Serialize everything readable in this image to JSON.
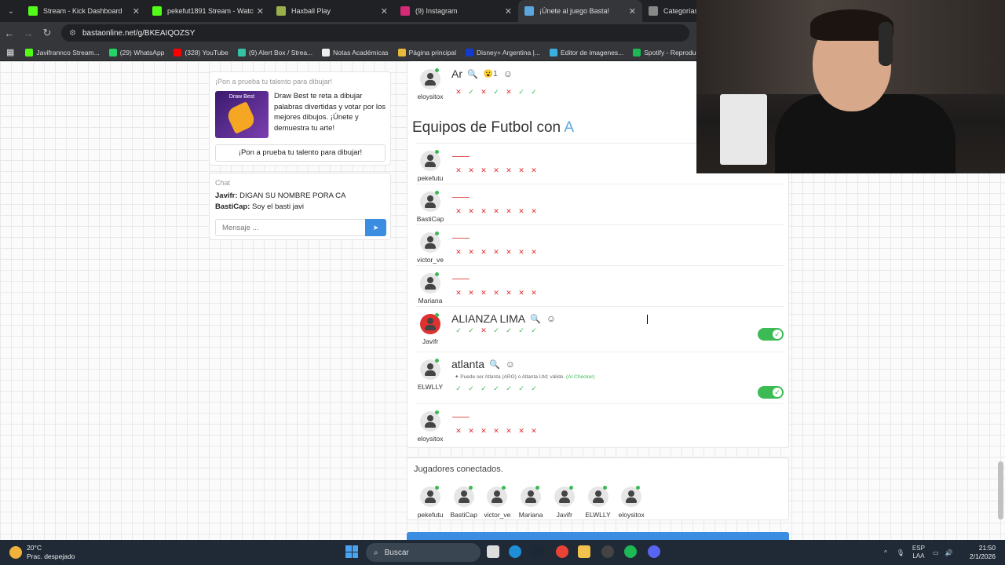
{
  "browser": {
    "tabs": [
      {
        "label": "Stream - Kick Dashboard",
        "color": "#53fc18"
      },
      {
        "label": "pekefut1891 Stream - Watch Li",
        "color": "#53fc18"
      },
      {
        "label": "Haxball Play",
        "color": "#9ab04a"
      },
      {
        "label": "(9) Instagram",
        "color": "#d62976"
      },
      {
        "label": "¡Únete al juego Basta!",
        "color": "#5aa7e0"
      },
      {
        "label": "Categorías Tr",
        "color": "#888888"
      }
    ],
    "active_tab": 4,
    "url": "bastaonline.net/g/BKEAIQOZSY",
    "bookmarks": [
      {
        "label": "Javifrannco Stream...",
        "color": "#53fc18"
      },
      {
        "label": "(29) WhatsApp",
        "color": "#25d366"
      },
      {
        "label": "(328) YouTube",
        "color": "#ff0000"
      },
      {
        "label": "(9) Alert Box / Strea...",
        "color": "#31c3a2"
      },
      {
        "label": "Notas Académicas",
        "color": "#eeeeee"
      },
      {
        "label": "Página principal",
        "color": "#e8b83a"
      },
      {
        "label": "Disney+ Argentina |...",
        "color": "#113ccf"
      },
      {
        "label": "Editor de imagenes...",
        "color": "#3ab0e0"
      },
      {
        "label": "Spotify - Reproduct...",
        "color": "#1db954"
      }
    ]
  },
  "promo": {
    "heading": "¡Pon a prueba tu talento para dibujar!",
    "image_title": "Draw Best",
    "text": "Draw Best te reta a dibujar palabras divertidas y votar por los mejores dibujos. ¡Únete y demuestra tu arte!",
    "button": "¡Pon a prueba tu talento para dibujar!"
  },
  "chat": {
    "heading": "Chat",
    "messages": [
      {
        "user": "Javifr:",
        "text": "DIGAN SU NOMBRE PORA CA"
      },
      {
        "user": "BastiCap:",
        "text": "Soy el basti javi"
      }
    ],
    "placeholder": "Mensaje ..."
  },
  "prev_answer": {
    "word": "Ar",
    "reaction": "😮1",
    "player": "eloysitox",
    "votes": [
      "x",
      "ok",
      "x",
      "ok",
      "x",
      "ok",
      "ok"
    ]
  },
  "category": {
    "title": "Equipos de Futbol con",
    "letter": "A"
  },
  "answers": [
    {
      "player": "pekefutu",
      "answer": "",
      "votes": [
        "x",
        "x",
        "x",
        "x",
        "x",
        "x",
        "x"
      ],
      "toggle": false
    },
    {
      "player": "BastiCap",
      "answer": "",
      "votes": [
        "x",
        "x",
        "x",
        "x",
        "x",
        "x",
        "x"
      ],
      "toggle": false
    },
    {
      "player": "victor_ve",
      "answer": "",
      "votes": [
        "x",
        "x",
        "x",
        "x",
        "x",
        "x",
        "x"
      ],
      "toggle": false
    },
    {
      "player": "Mariana",
      "answer": "",
      "votes": [
        "x",
        "x",
        "x",
        "x",
        "x",
        "x",
        "x"
      ],
      "toggle": false
    },
    {
      "player": "Javifr",
      "answer": "ALIANZA LIMA",
      "votes": [
        "ok",
        "ok",
        "x",
        "ok",
        "ok",
        "ok",
        "ok"
      ],
      "toggle": true,
      "stop": true
    },
    {
      "player": "ELWLLY",
      "answer": "atlanta",
      "note": "Puede ser Atlanta (ARG) o Atlanta Utd; válido.",
      "note_tag": "(AI Checker)",
      "votes": [
        "ok",
        "ok",
        "ok",
        "ok",
        "ok",
        "ok",
        "ok"
      ],
      "toggle": true
    },
    {
      "player": "eloysitox",
      "answer": "",
      "votes": [
        "x",
        "x",
        "x",
        "x",
        "x",
        "x",
        "x"
      ],
      "toggle": false
    }
  ],
  "connected": {
    "title": "Jugadores conectados.",
    "players": [
      "pekefutu",
      "BastiCap",
      "victor_ve",
      "Mariana",
      "Javifr",
      "ELWLLY",
      "eloysitox"
    ]
  },
  "taskbar": {
    "temp": "20°C",
    "weather": "Prac. despejado",
    "search": "Buscar",
    "lang1": "ESP",
    "lang2": "LAA",
    "time": "21:50",
    "date": "2/1/2026"
  }
}
